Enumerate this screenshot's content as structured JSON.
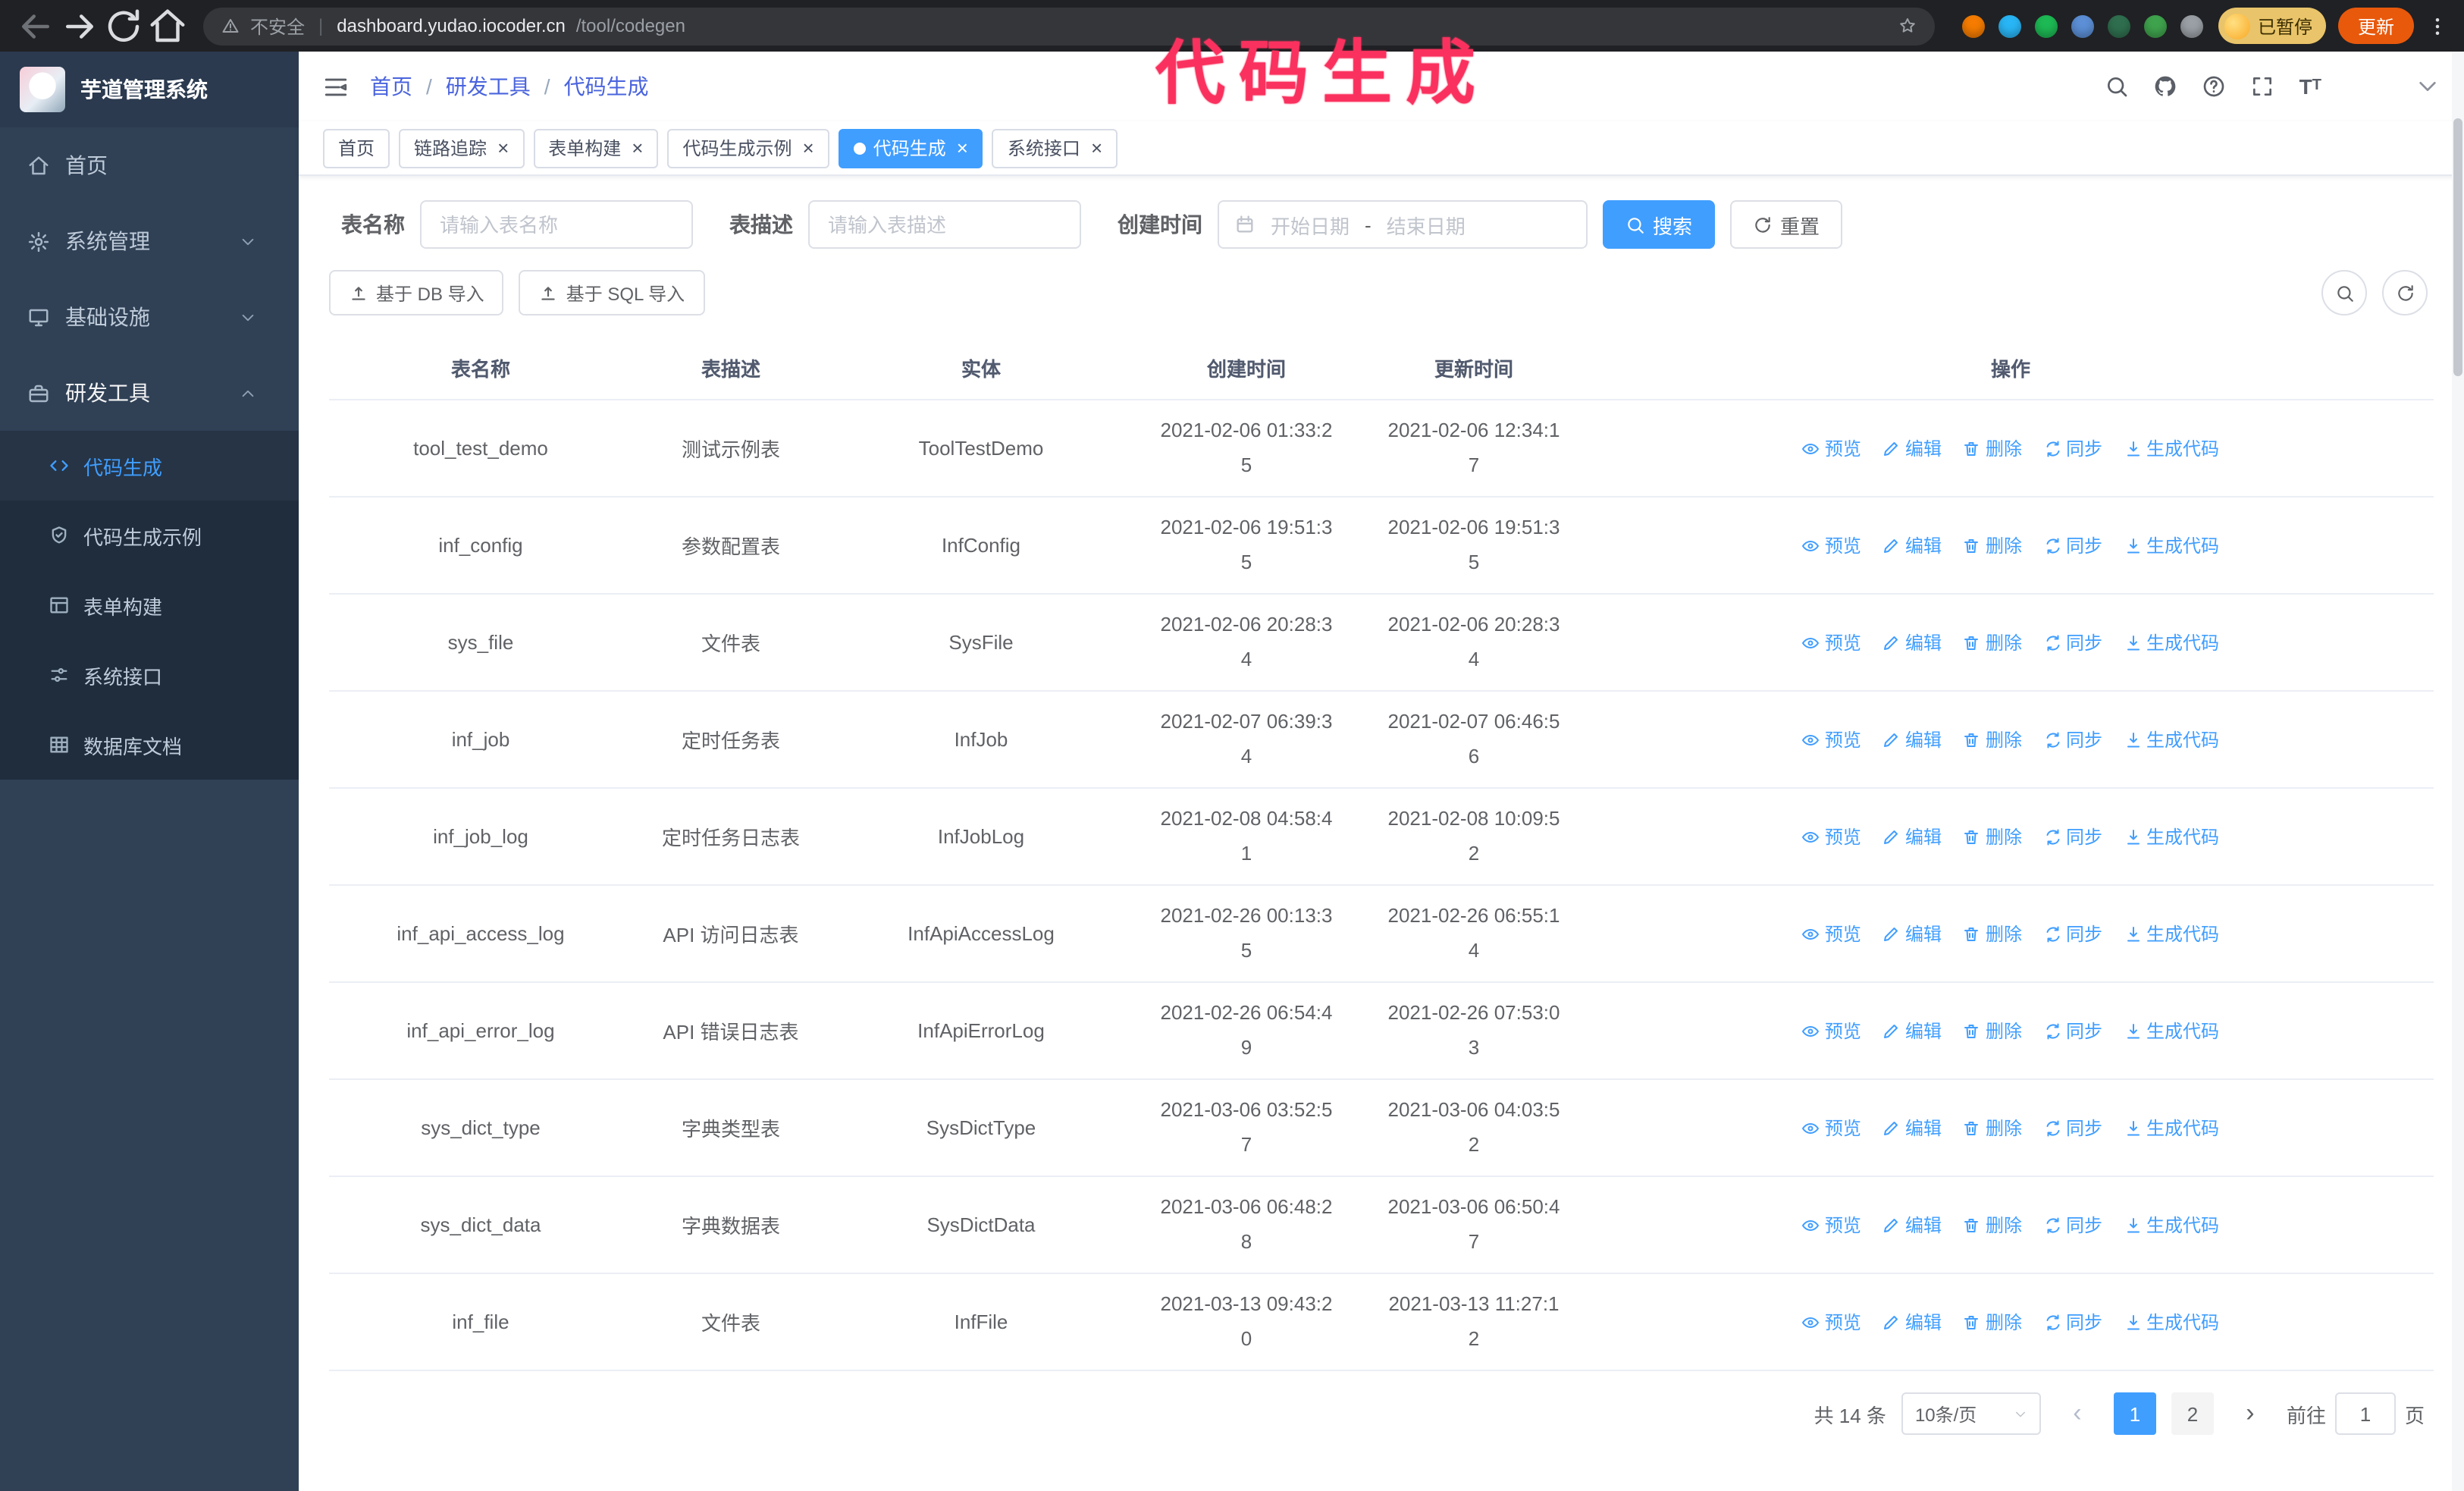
{
  "colors": {
    "accent": "#409eff",
    "sidebar_bg": "#304156",
    "submenu_bg": "#1f2d3d",
    "breadcrumb": "#4a64dd",
    "annotation": "#fa315e",
    "update_button": "#e8590c",
    "chip_bg": "#e9c46a"
  },
  "annotation": {
    "text": "代码生成"
  },
  "browser": {
    "security_label": "不安全",
    "url_domain": "dashboard.yudao.iocoder.cn",
    "url_path": "/tool/codegen",
    "url_separator": "|",
    "profile_chip": "已暂停",
    "update_button": "更新",
    "extensions": [
      {
        "name": "fox-extension-icon",
        "color": "#f57c00"
      },
      {
        "name": "drop-extension-icon",
        "color": "#29b6f6"
      },
      {
        "name": "check-extension-icon",
        "color": "#1db954"
      },
      {
        "name": "users-extension-icon",
        "color": "#5c8fd6"
      },
      {
        "name": "bank-extension-icon",
        "color": "#2f6f4f"
      },
      {
        "name": "leaf-extension-icon",
        "color": "#3fa34d"
      },
      {
        "name": "puzzle-extension-icon",
        "color": "#9aa0a6"
      }
    ]
  },
  "sidebar": {
    "logo_title": "芋道管理系统",
    "items": [
      {
        "label": "首页",
        "icon": "home-icon",
        "chevron": null,
        "open": false
      },
      {
        "label": "系统管理",
        "icon": "gear-icon",
        "chevron": "down",
        "open": false
      },
      {
        "label": "基础设施",
        "icon": "infra-icon",
        "chevron": "down",
        "open": false
      },
      {
        "label": "研发工具",
        "icon": "tools-icon",
        "chevron": "up",
        "open": true
      }
    ],
    "submenu": [
      {
        "label": "代码生成",
        "icon": "code-icon",
        "active": true
      },
      {
        "label": "代码生成示例",
        "icon": "badge-icon",
        "active": false
      },
      {
        "label": "表单构建",
        "icon": "form-icon",
        "active": false
      },
      {
        "label": "系统接口",
        "icon": "api-icon",
        "active": false
      },
      {
        "label": "数据库文档",
        "icon": "dbdoc-icon",
        "active": false
      }
    ]
  },
  "header": {
    "breadcrumb": [
      "首页",
      "研发工具",
      "代码生成"
    ],
    "breadcrumb_separator": "/"
  },
  "tabs": [
    {
      "label": "首页",
      "closable": false,
      "active": false
    },
    {
      "label": "链路追踪",
      "closable": true,
      "active": false
    },
    {
      "label": "表单构建",
      "closable": true,
      "active": false
    },
    {
      "label": "代码生成示例",
      "closable": true,
      "active": false
    },
    {
      "label": "代码生成",
      "closable": true,
      "active": true
    },
    {
      "label": "系统接口",
      "closable": true,
      "active": false
    }
  ],
  "filters": {
    "table_name_label": "表名称",
    "table_name_placeholder": "请输入表名称",
    "table_desc_label": "表描述",
    "table_desc_placeholder": "请输入表描述",
    "create_time_label": "创建时间",
    "date_start_placeholder": "开始日期",
    "date_separator": "-",
    "date_end_placeholder": "结束日期",
    "search_button": "搜索",
    "reset_button": "重置"
  },
  "toolbar": {
    "import_db_button": "基于 DB 导入",
    "import_sql_button": "基于 SQL 导入"
  },
  "table": {
    "columns": [
      "表名称",
      "表描述",
      "实体",
      "创建时间",
      "更新时间",
      "操作"
    ],
    "actions": [
      "预览",
      "编辑",
      "删除",
      "同步",
      "生成代码"
    ],
    "rows": [
      {
        "name": "tool_test_demo",
        "desc": "测试示例表",
        "entity": "ToolTestDemo",
        "created": "2021-02-06 01:33:25",
        "updated": "2021-02-06 12:34:17"
      },
      {
        "name": "inf_config",
        "desc": "参数配置表",
        "entity": "InfConfig",
        "created": "2021-02-06 19:51:35",
        "updated": "2021-02-06 19:51:35"
      },
      {
        "name": "sys_file",
        "desc": "文件表",
        "entity": "SysFile",
        "created": "2021-02-06 20:28:34",
        "updated": "2021-02-06 20:28:34"
      },
      {
        "name": "inf_job",
        "desc": "定时任务表",
        "entity": "InfJob",
        "created": "2021-02-07 06:39:34",
        "updated": "2021-02-07 06:46:56"
      },
      {
        "name": "inf_job_log",
        "desc": "定时任务日志表",
        "entity": "InfJobLog",
        "created": "2021-02-08 04:58:41",
        "updated": "2021-02-08 10:09:52"
      },
      {
        "name": "inf_api_access_log",
        "desc": "API 访问日志表",
        "entity": "InfApiAccessLog",
        "created": "2021-02-26 00:13:35",
        "updated": "2021-02-26 06:55:14"
      },
      {
        "name": "inf_api_error_log",
        "desc": "API 错误日志表",
        "entity": "InfApiErrorLog",
        "created": "2021-02-26 06:54:49",
        "updated": "2021-02-26 07:53:03"
      },
      {
        "name": "sys_dict_type",
        "desc": "字典类型表",
        "entity": "SysDictType",
        "created": "2021-03-06 03:52:57",
        "updated": "2021-03-06 04:03:52"
      },
      {
        "name": "sys_dict_data",
        "desc": "字典数据表",
        "entity": "SysDictData",
        "created": "2021-03-06 06:48:28",
        "updated": "2021-03-06 06:50:47"
      },
      {
        "name": "inf_file",
        "desc": "文件表",
        "entity": "InfFile",
        "created": "2021-03-13 09:43:20",
        "updated": "2021-03-13 11:27:12"
      }
    ]
  },
  "pagination": {
    "total": "共 14 条",
    "page_size": "10条/页",
    "pages": [
      "1",
      "2"
    ],
    "active_page": "1",
    "goto_prefix": "前往",
    "goto_value": "1",
    "goto_suffix": "页"
  }
}
